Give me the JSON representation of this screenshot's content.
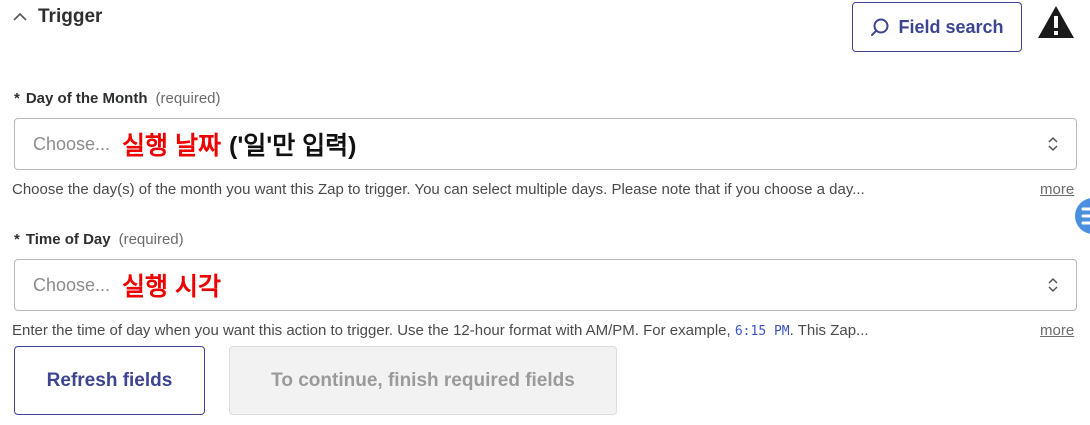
{
  "section": {
    "title": "Trigger"
  },
  "toolbar": {
    "field_search_label": "Field search"
  },
  "fields": [
    {
      "required_marker": "*",
      "label": "Day of the Month",
      "required_text": "(required)",
      "placeholder": "Choose...",
      "annotation": "실행 날짜",
      "annotation_extra": "('일'만 입력)",
      "help_text": "Choose the day(s) of the month you want this Zap to trigger. You can select multiple days. Please note that if you choose a day...",
      "more_label": "more"
    },
    {
      "required_marker": "*",
      "label": "Time of Day",
      "required_text": "(required)",
      "placeholder": "Choose...",
      "annotation": "실행 시각",
      "help_text_before": "Enter the time of day when you want this action to trigger. Use the 12-hour format with AM/PM. For example,",
      "help_code": "6:15 PM",
      "help_text_after": ". This Zap...",
      "more_label": "more"
    }
  ],
  "buttons": {
    "refresh_label": "Refresh fields",
    "continue_label": "To continue, finish required fields"
  },
  "icons": {
    "section_toggle": "chevron-up-icon",
    "field_search": "search-icon",
    "warning": "warning-icon",
    "select": "updown-chevron-icon",
    "edge": "link-icon"
  },
  "colors": {
    "accent": "#3d4592",
    "annotation": "#ee0000",
    "warning": "#1a1a1a"
  }
}
